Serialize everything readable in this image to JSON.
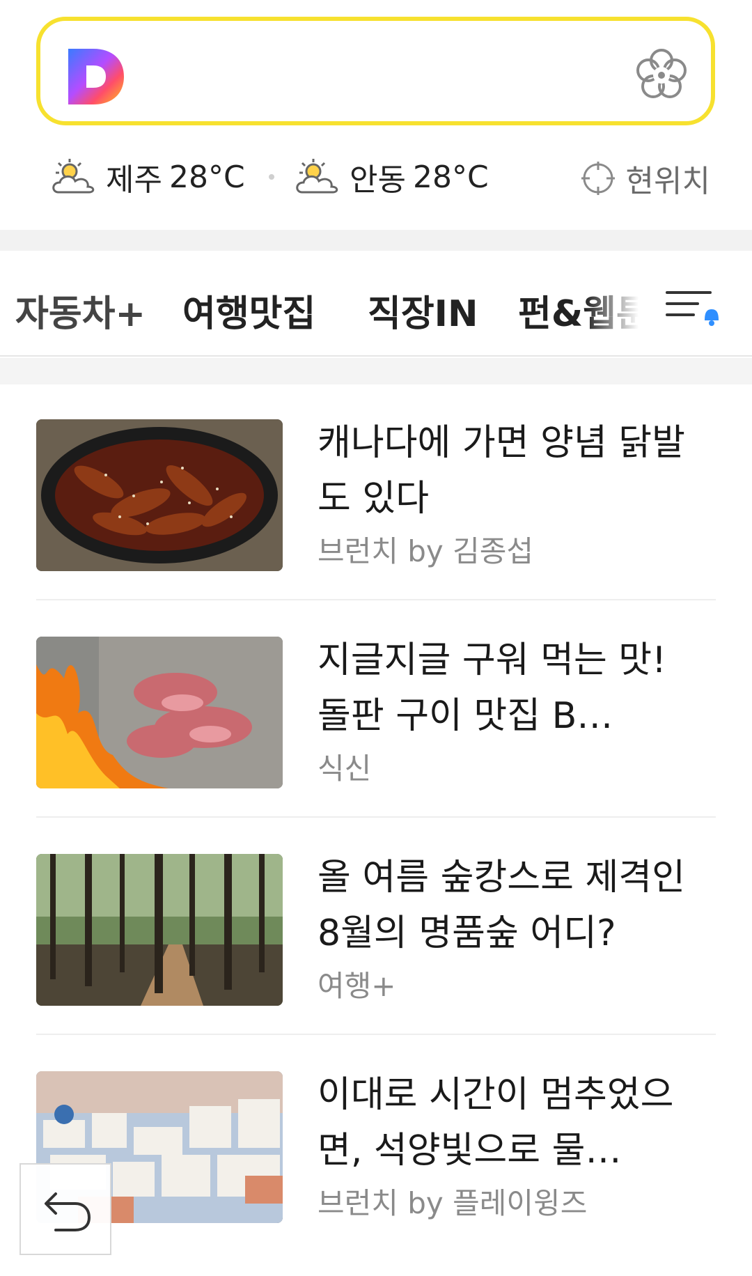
{
  "search": {
    "logo_alt": "D",
    "placeholder": ""
  },
  "weather": [
    {
      "city": "제주",
      "temp": "28°C",
      "icon": "partly-cloudy-icon"
    },
    {
      "city": "안동",
      "temp": "28°C",
      "icon": "partly-cloudy-icon"
    }
  ],
  "location": {
    "label": "현위치",
    "icon": "crosshair-icon"
  },
  "tabs": [
    {
      "label": "자동차+"
    },
    {
      "label": "여행맛집",
      "active": true
    },
    {
      "label": "직장IN"
    },
    {
      "label": "펀&웹툰"
    }
  ],
  "menu": {
    "icon": "menu-bell-icon"
  },
  "articles": [
    {
      "title": "캐나다에 가면 양념 닭발도 있다",
      "source": "브런치 by 김종섭"
    },
    {
      "title": "지글지글 구워 먹는 맛! 돌판 구이 맛집 B…",
      "source": "식신"
    },
    {
      "title": "올 여름 숲캉스로 제격인 8월의 명품숲 어디?",
      "source": "여행+"
    },
    {
      "title": "이대로 시간이 멈추었으면, 석양빛으로 물…",
      "source": "브런치 by 플레이윙즈"
    }
  ],
  "colors": {
    "search_border": "#f7e12f",
    "accent_blue": "#2f8fff"
  }
}
